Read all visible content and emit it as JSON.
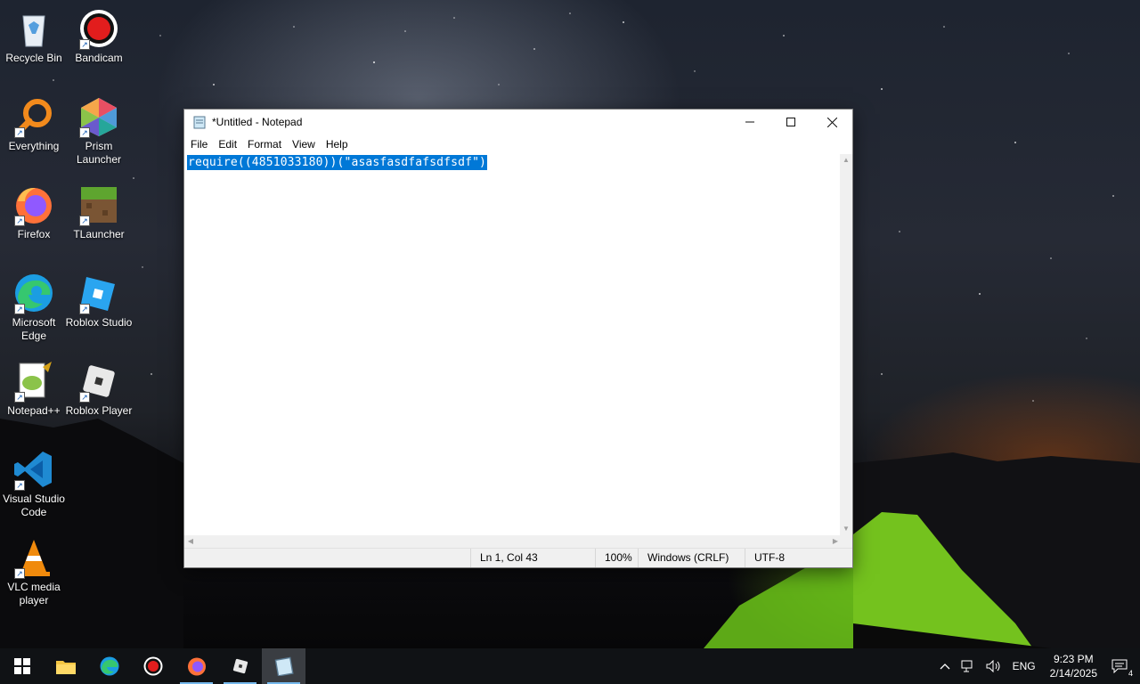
{
  "desktop": {
    "icons": [
      {
        "label": "Recycle Bin",
        "icon": "recycle-bin-icon"
      },
      {
        "label": "Bandicam",
        "icon": "bandicam-icon"
      },
      {
        "label": "Everything",
        "icon": "everything-icon"
      },
      {
        "label": "Prism Launcher",
        "icon": "prism-launcher-icon"
      },
      {
        "label": "Firefox",
        "icon": "firefox-icon"
      },
      {
        "label": "TLauncher",
        "icon": "tlauncher-icon"
      },
      {
        "label": "Microsoft Edge",
        "icon": "edge-icon"
      },
      {
        "label": "Roblox Studio",
        "icon": "roblox-studio-icon"
      },
      {
        "label": "Notepad++",
        "icon": "notepadpp-icon"
      },
      {
        "label": "Roblox Player",
        "icon": "roblox-player-icon"
      },
      {
        "label": "Visual Studio Code",
        "icon": "vscode-icon"
      },
      {
        "label": "VLC media player",
        "icon": "vlc-icon"
      }
    ]
  },
  "notepad": {
    "title": "*Untitled - Notepad",
    "menu": [
      "File",
      "Edit",
      "Format",
      "View",
      "Help"
    ],
    "content": "require((4851033180))(\"asasfasdfafsdfsdf\")",
    "status": {
      "position": "Ln 1, Col 43",
      "zoom": "100%",
      "line_endings": "Windows (CRLF)",
      "encoding": "UTF-8"
    }
  },
  "taskbar": {
    "apps": [
      "start-icon",
      "file-explorer-icon",
      "edge-icon",
      "bandicam-icon",
      "firefox-icon",
      "roblox-icon",
      "notepad-icon"
    ],
    "language": "ENG",
    "time": "9:23 PM",
    "date": "2/14/2025",
    "notification_count": "4"
  }
}
